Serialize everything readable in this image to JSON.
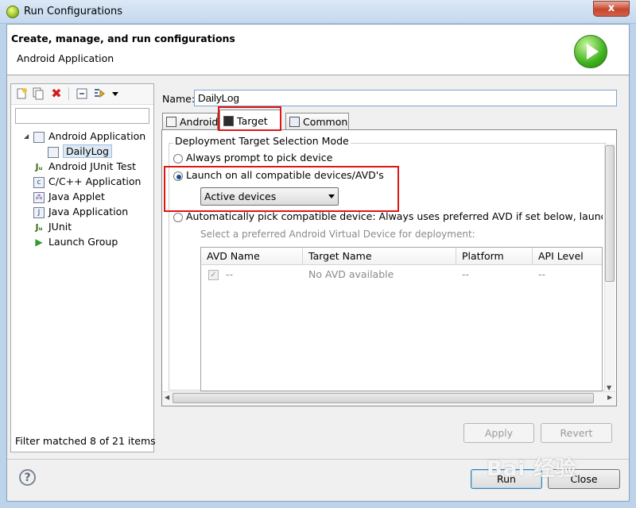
{
  "window": {
    "title": "Run Configurations",
    "close_glyph": "x"
  },
  "header": {
    "title": "Create, manage, and run configurations",
    "subtitle": "Android Application",
    "icon": "run-icon"
  },
  "left_panel": {
    "toolbar_icons": [
      "new-config-icon",
      "duplicate-icon",
      "delete-icon",
      "collapse-all-icon",
      "filter-icon",
      "dropdown-arrow-icon"
    ],
    "filter_placeholder": "",
    "tree": [
      {
        "label": "Android Application",
        "icon": "android-app-icon",
        "expanded": true
      },
      {
        "label": "DailyLog",
        "icon": "android-config-icon",
        "selected": true
      },
      {
        "label": "Android JUnit Test",
        "icon": "junit-icon"
      },
      {
        "label": "C/C++ Application",
        "icon": "c-app-icon"
      },
      {
        "label": "Java Applet",
        "icon": "applet-icon"
      },
      {
        "label": "Java Application",
        "icon": "java-app-icon"
      },
      {
        "label": "JUnit",
        "icon": "junit-icon"
      },
      {
        "label": "Launch Group",
        "icon": "launch-group-icon"
      }
    ],
    "status": "Filter matched 8 of 21 items"
  },
  "config": {
    "name_label": "Name:",
    "name_value": "DailyLog",
    "tabs": [
      {
        "label": "Android",
        "selected": false
      },
      {
        "label": "Target",
        "selected": true
      },
      {
        "label": "Common",
        "selected": false
      }
    ],
    "group_title": "Deployment Target Selection Mode",
    "options": [
      {
        "label": "Always prompt to pick device",
        "checked": false
      },
      {
        "label": "Launch on all compatible devices/AVD's",
        "checked": true
      },
      {
        "label": "Automatically pick compatible device: Always uses preferred AVD if set below, launches on",
        "checked": false
      }
    ],
    "device_combo": "Active devices",
    "preferred_hint": "Select a preferred Android Virtual Device for deployment:",
    "table": {
      "columns": [
        "AVD Name",
        "Target Name",
        "Platform",
        "API Level"
      ],
      "rows": [
        {
          "checked": true,
          "avd": "--",
          "target": "No AVD available",
          "platform": "--",
          "api": "--"
        }
      ]
    }
  },
  "buttons": {
    "apply": "Apply",
    "revert": "Revert",
    "run": "Run",
    "close": "Close",
    "help": "?"
  },
  "watermark": "Bai 经验",
  "colors": {
    "highlight_box": "#e01515",
    "selection": "#dde8f5",
    "accent": "#3c7fb1"
  }
}
